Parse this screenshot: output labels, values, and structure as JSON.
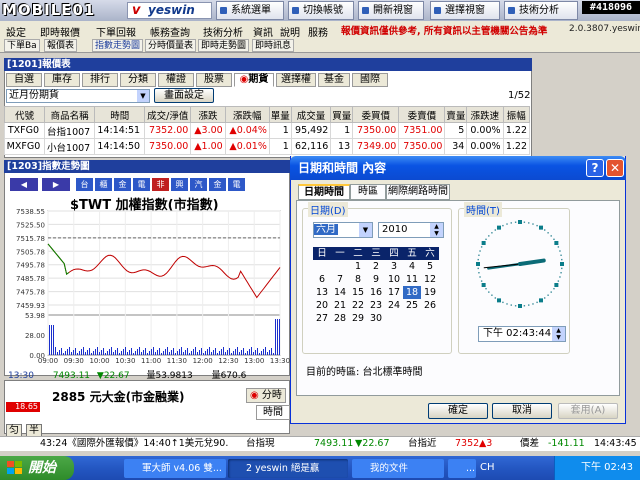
{
  "header": {
    "logo": "MOBILE01",
    "brand": "yeswin",
    "brand_mark": "v",
    "buttons": [
      "系統選單",
      "切換帳號",
      "開新視窗",
      "選擇視窗",
      "技術分析"
    ],
    "serial": "#418096"
  },
  "menu": {
    "items": [
      "設定",
      "即時報價",
      "下單回報",
      "帳務查詢",
      "技術分析",
      "資訊",
      "說明",
      "服務"
    ],
    "notice": "報價資訊僅供參考, 所有資訊以主管機關公告為準",
    "version": "2.0.3807.yeswin"
  },
  "subtoolbar": [
    "下單Ba",
    "報價表",
    "指數走勢圖",
    "分時價量表",
    "即時走勢圖",
    "即時訊息"
  ],
  "quote_panel": {
    "title": "[1201]報價表",
    "tabs": [
      "自選",
      "庫存",
      "排行",
      "分類",
      "權證",
      "股票",
      "期貨",
      "選擇權",
      "基金",
      "國際"
    ],
    "dropdown": "近月份期貨",
    "settings_button": "畫面設定",
    "page": "1/52",
    "columns": [
      "代號",
      "商品名稱",
      "時間",
      "成交/淨值",
      "漲跌",
      "漲跌幅",
      "單量",
      "成交量",
      "買量",
      "委買價",
      "委賣價",
      "賣量",
      "漲跌速",
      "振幅"
    ],
    "rows": [
      [
        "TXFG0",
        "台指1007",
        "14:14:51",
        "7352.00",
        "▲3.00",
        "▲0.04%",
        "1",
        "95,492",
        "1",
        "7350.00",
        "7351.00",
        "5",
        "0.00%",
        "1.22"
      ],
      [
        "MXFG0",
        "小台1007",
        "14:14:50",
        "7350.00",
        "▲1.00",
        "▲0.01%",
        "1",
        "62,116",
        "13",
        "7349.00",
        "7350.00",
        "34",
        "0.00%",
        "1.22"
      ]
    ]
  },
  "chart_panel": {
    "title": "[1203]指數走勢圖",
    "button_glyphs": [
      "台",
      "櫃",
      "金",
      "電",
      "非",
      "興",
      "汽",
      "金",
      "電"
    ],
    "chart_title": "$TWT 加權指數(市指數)",
    "price_ticks": [
      "7538.55",
      "7525.50",
      "7515.78",
      "7505.78",
      "7495.78",
      "7485.78",
      "7475.78",
      "7459.93"
    ],
    "volume_ticks": [
      "53.98",
      "28.00",
      "0.00"
    ],
    "time_ticks": [
      "09:00",
      "09:30",
      "10:00",
      "10:30",
      "11:00",
      "11:30",
      "12:00",
      "12:30",
      "13:00",
      "13:30"
    ],
    "footer_time": "13:30",
    "footer_price": "7493.11",
    "footer_change": "▼22.67",
    "footer_volume": "量53.9813",
    "footer_last": "量670.6"
  },
  "lower_panel": {
    "title": "2885 元大金(市金融業)",
    "price": "18.65",
    "tab_label": "分時",
    "time_label": "時間",
    "glyphs": [
      "匀",
      "半"
    ]
  },
  "dialog": {
    "title": "日期和時間 內容",
    "tabs": [
      "日期時間",
      "時區",
      "網際網路時間"
    ],
    "date_label": "日期(D)",
    "time_label": "時間(T)",
    "month": "六月",
    "year": "2010",
    "weekdays": [
      "日",
      "一",
      "二",
      "三",
      "四",
      "五",
      "六"
    ],
    "weeks": [
      [
        "",
        "",
        "1",
        "2",
        "3",
        "4",
        "5"
      ],
      [
        "6",
        "7",
        "8",
        "9",
        "10",
        "11",
        "12"
      ],
      [
        "13",
        "14",
        "15",
        "16",
        "17",
        "18",
        "19"
      ],
      [
        "20",
        "21",
        "22",
        "23",
        "24",
        "25",
        "26"
      ],
      [
        "27",
        "28",
        "29",
        "30",
        "",
        "",
        ""
      ]
    ],
    "selected_day": "18",
    "time_value": "下午 02:43:44",
    "timezone": "目前的時區: 台北標準時間",
    "ok": "確定",
    "cancel": "取消",
    "apply": "套用(A)"
  },
  "ticker": {
    "text1": "43:24《國際外匯報價》14:40↑1美元兌90.",
    "label1": "台指現",
    "value1": "7493.11",
    "change1": "▼22.67",
    "label2": "台指近",
    "value2": "7352",
    "change2": "▲3",
    "label3": "價差",
    "value3": "-141.11",
    "time": "14:43:45"
  },
  "taskbar": {
    "start": "開始",
    "items": [
      "軍大師 v4.06 雙...",
      "2 yeswin 絕是贏",
      "我的文件",
      "..."
    ],
    "lang": "CH",
    "clock": "下午 02:43"
  },
  "colors": {
    "title_blue": "#1f3f9d",
    "up_red": "#e00000",
    "down_green": "#008800",
    "xp_blue": "#0a54e3"
  }
}
